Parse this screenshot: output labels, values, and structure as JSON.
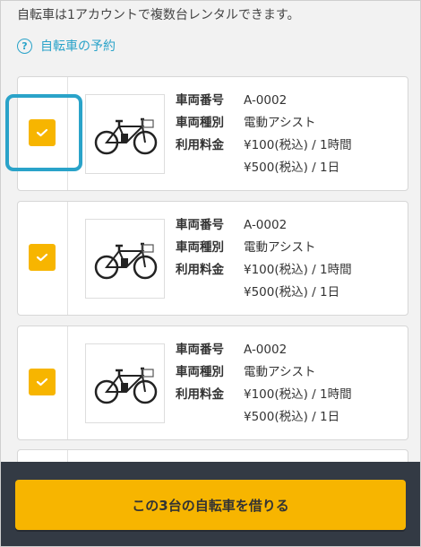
{
  "intro_text": "自転車は1アカウントで複数台レンタルできます。",
  "reserve_link": {
    "icon": "question-circle-icon",
    "label": "自転車の予約"
  },
  "colors": {
    "accent": "#2aa3c9",
    "checkbox": "#f7b500",
    "footer": "#333a44",
    "button": "#f7b500"
  },
  "cards": [
    {
      "checked": true,
      "image": "bicycle-icon",
      "vehicle_number_label": "車両番号",
      "vehicle_number": "A-0002",
      "vehicle_type_label": "車両種別",
      "vehicle_type": "電動アシスト",
      "fee_label": "利用料金",
      "fee_hour": "¥100(税込) / 1時間",
      "fee_day": "¥500(税込) / 1日"
    },
    {
      "checked": true,
      "image": "bicycle-icon",
      "vehicle_number_label": "車両番号",
      "vehicle_number": "A-0002",
      "vehicle_type_label": "車両種別",
      "vehicle_type": "電動アシスト",
      "fee_label": "利用料金",
      "fee_hour": "¥100(税込) / 1時間",
      "fee_day": "¥500(税込) / 1日"
    },
    {
      "checked": true,
      "image": "bicycle-icon",
      "vehicle_number_label": "車両番号",
      "vehicle_number": "A-0002",
      "vehicle_type_label": "車両種別",
      "vehicle_type": "電動アシスト",
      "fee_label": "利用料金",
      "fee_hour": "¥100(税込) / 1時間",
      "fee_day": "¥500(税込) / 1日"
    }
  ],
  "footer": {
    "button_label": "この3台の自転車を借りる"
  }
}
